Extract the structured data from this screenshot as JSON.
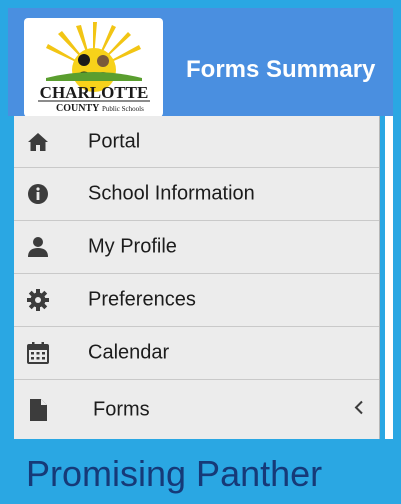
{
  "header": {
    "title": "Forms Summary",
    "logo_text_line1": "CHARLOTTE",
    "logo_text_line2": "COUNTY",
    "logo_text_line3": "Public Schools"
  },
  "menu": [
    {
      "label": "Portal",
      "icon": "home-icon"
    },
    {
      "label": "School Information",
      "icon": "info-icon"
    },
    {
      "label": "My Profile",
      "icon": "user-icon"
    },
    {
      "label": "Preferences",
      "icon": "gear-icon"
    },
    {
      "label": "Calendar",
      "icon": "calendar-icon"
    },
    {
      "label": "Forms",
      "icon": "file-icon",
      "expand_icon": "chevron-left-icon"
    }
  ],
  "footer": {
    "text": "Promising Panther"
  },
  "colors": {
    "frame": "#2aa7e3",
    "header": "#4a8fe0",
    "sidebar": "#ececec",
    "footer_text": "#163a78"
  }
}
